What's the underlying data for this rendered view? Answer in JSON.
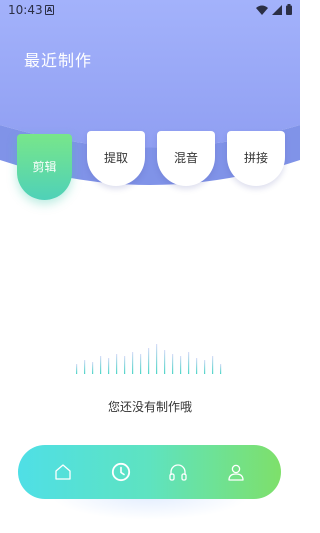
{
  "status_bar": {
    "time": "10:43",
    "notification_icon": "a-icon",
    "icons": [
      "wifi-icon",
      "signal-icon",
      "battery-icon"
    ]
  },
  "header": {
    "title": "最近制作",
    "gradient_top": "#a3b2fb",
    "gradient_bottom": "#8ea0f0",
    "arc_color": "#7f93e8"
  },
  "tabs": [
    {
      "label": "剪辑",
      "active": true
    },
    {
      "label": "提取",
      "active": false
    },
    {
      "label": "混音",
      "active": false
    },
    {
      "label": "拼接",
      "active": false
    }
  ],
  "empty_state": {
    "message": "您还没有制作哦",
    "icon": "waveform-icon"
  },
  "bottom_nav": {
    "items": [
      {
        "icon": "home-icon"
      },
      {
        "icon": "clock-icon",
        "active": true
      },
      {
        "icon": "headphones-icon"
      },
      {
        "icon": "user-icon"
      }
    ],
    "gradient_start": "#4fdfe6",
    "gradient_end": "#7ee06a"
  }
}
